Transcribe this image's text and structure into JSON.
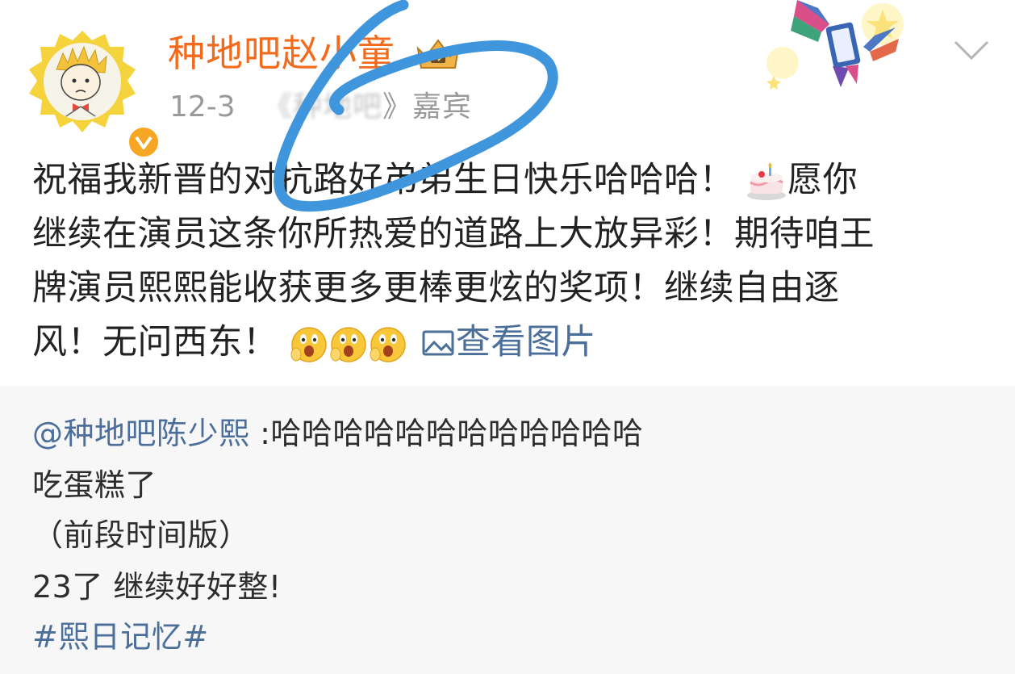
{
  "post": {
    "author_name": "种地吧赵小童",
    "date": "12-3",
    "source_blurred": "《种地吧",
    "source_suffix": "》嘉宾",
    "text_lines": [
      "祝福我新晋的对抗路好弟弟生日快乐哈哈哈！",
      "愿你",
      "继续在演员这条你所热爱的道路上大放异彩！期待咱王",
      "牌演员熙熙能收获更多更棒更炫的奖项！继续自由逐",
      "风！无问西东！"
    ],
    "view_images_label": "查看图片",
    "icons": [
      "avatar-cartoon",
      "verified-badge-icon",
      "crown-badge-icon",
      "cake-emoji",
      "surprised-emoji",
      "image-icon",
      "chevron-down-icon",
      "bird-card-decoration"
    ]
  },
  "repost": {
    "mention": "@种地吧陈少熙",
    "mention_text": ":哈哈哈哈哈哈哈哈哈哈哈哈",
    "line2": "吃蛋糕了",
    "line3": "（前段时间版）",
    "line4": "23了 继续好好整!",
    "topic": "#熙日记忆#"
  },
  "colors": {
    "author": "#f26b1d",
    "link": "#4b6f9a",
    "meta": "#9a9a9a",
    "scribble": "#3f96dd",
    "repost_bg": "#f7f7f7"
  }
}
